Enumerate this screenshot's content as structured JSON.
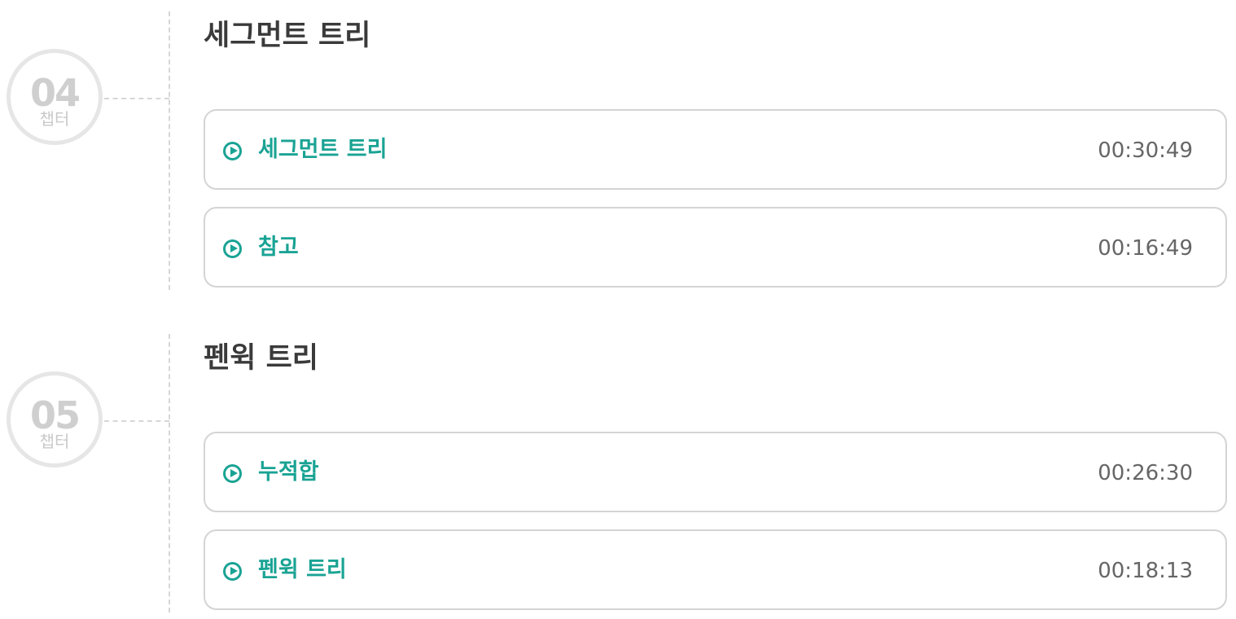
{
  "chapters": [
    {
      "number": "04",
      "label": "챕터",
      "title": "세그먼트 트리",
      "lessons": [
        {
          "title": "세그먼트 트리",
          "duration": "00:30:49"
        },
        {
          "title": "참고",
          "duration": "00:16:49"
        }
      ]
    },
    {
      "number": "05",
      "label": "챕터",
      "title": "펜윅 트리",
      "lessons": [
        {
          "title": "누적합",
          "duration": "00:26:30"
        },
        {
          "title": "펜윅 트리",
          "duration": "00:18:13"
        }
      ]
    }
  ],
  "colors": {
    "accent": "#1aa394",
    "title": "#3a3a3a",
    "badge": "#cfcfcf",
    "duration": "#666666",
    "border": "#d4d4d4"
  },
  "icons": {
    "lesson": "play-circle-icon"
  }
}
